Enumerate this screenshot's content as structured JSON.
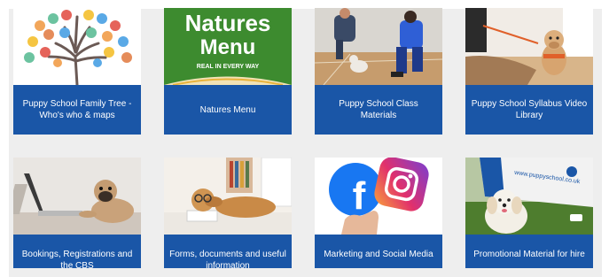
{
  "cards": [
    {
      "title": "Puppy School Family Tree - Who's who & maps",
      "image": "family-tree-image"
    },
    {
      "title": "Natures Menu",
      "image": "natures-menu-logo",
      "logo_line1": "Natures",
      "logo_line2": "Menu",
      "logo_tagline": "REAL IN EVERY WAY"
    },
    {
      "title": "Puppy School Class Materials",
      "image": "class-photo"
    },
    {
      "title": "Puppy School Syllabus Video Library",
      "image": "syllabus-photo"
    },
    {
      "title": "Bookings, Registrations and the CBS",
      "image": "pug-laptop-photo"
    },
    {
      "title": "Forms, documents and useful information",
      "image": "dog-glasses-photo"
    },
    {
      "title": "Marketing and Social Media",
      "image": "social-media-photo"
    },
    {
      "title": "Promotional Material for hire",
      "image": "banner-dog-photo",
      "banner_text": "www.puppyschool.co.uk"
    }
  ],
  "colors": {
    "caption_bg": "#1a56a7",
    "caption_text": "#ffffff",
    "panel_bg": "#eeeeee"
  }
}
